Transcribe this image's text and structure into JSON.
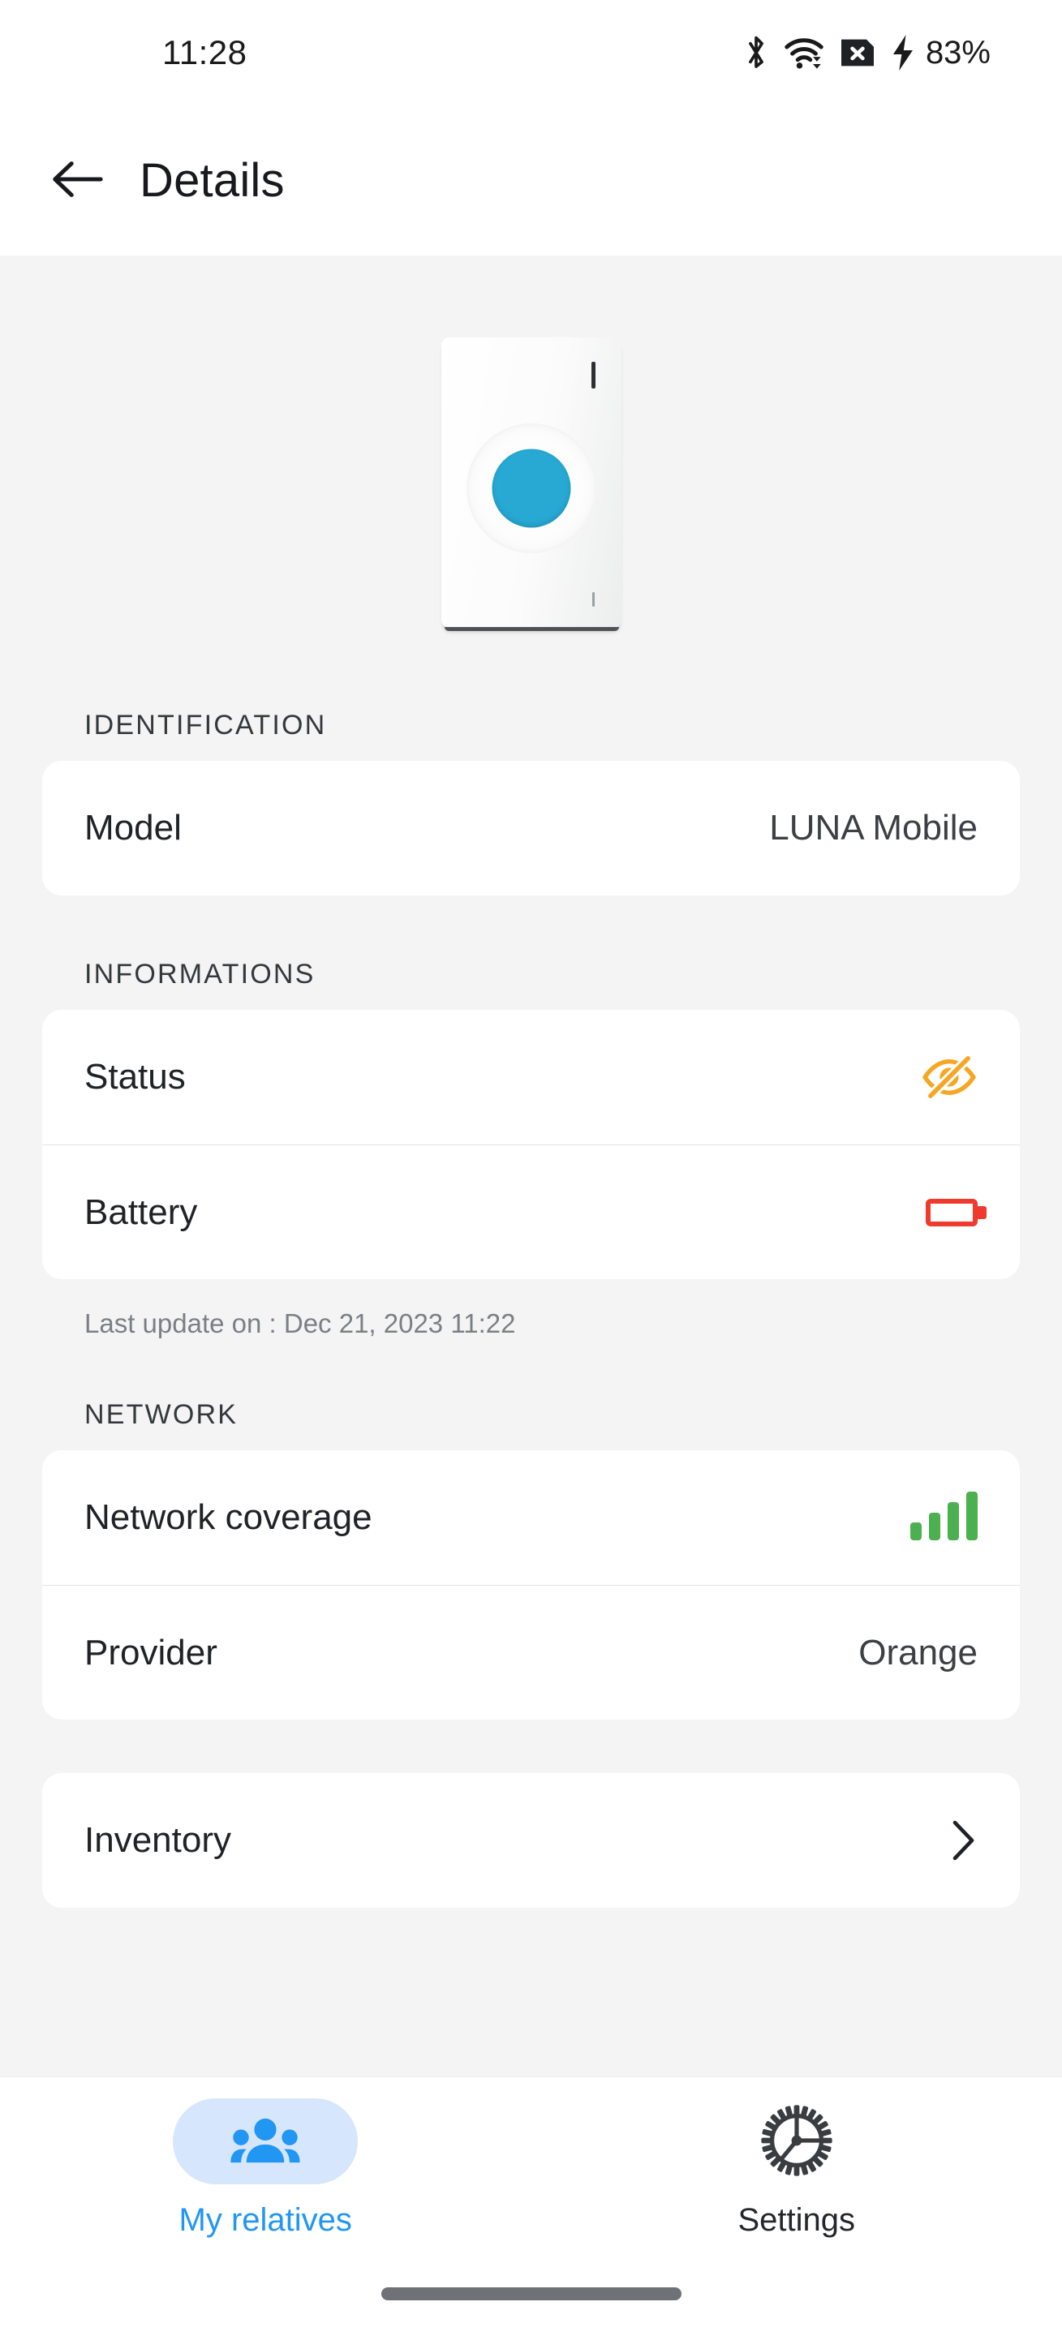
{
  "status_bar": {
    "time": "11:28",
    "battery_percent": "83%",
    "icons": [
      "bluetooth-icon",
      "wifi-icon",
      "sim-card-off-icon",
      "charging-bolt-icon"
    ]
  },
  "app_bar": {
    "back_label": "back-arrow-icon",
    "title": "Details"
  },
  "device_preview": {
    "name": "device-image",
    "button_color": "#27A9D4",
    "body_color": "#FFFFFF"
  },
  "sections": {
    "identification": {
      "label": "IDENTIFICATION",
      "rows": [
        {
          "label": "Model",
          "value": "LUNA Mobile",
          "type": "text"
        }
      ]
    },
    "informations": {
      "label": "INFORMATIONS",
      "rows": [
        {
          "label": "Status",
          "value": "",
          "type": "icon",
          "icon": "eye-off-icon",
          "color": "#F5A623"
        },
        {
          "label": "Battery",
          "value": "",
          "type": "icon",
          "icon": "battery-empty-icon",
          "color": "#EF3B2D"
        }
      ],
      "footnote": "Last update on : Dec 21, 2023 11:22"
    },
    "network": {
      "label": "NETWORK",
      "rows": [
        {
          "label": "Network coverage",
          "value": "",
          "type": "icon",
          "icon": "signal-bars-icon",
          "color": "#4CAF50",
          "bars": 4
        },
        {
          "label": "Provider",
          "value": "Orange",
          "type": "text"
        }
      ]
    },
    "inventory": {
      "rows": [
        {
          "label": "Inventory",
          "value": "",
          "type": "chevron",
          "icon": "chevron-right-icon"
        }
      ]
    }
  },
  "bottom_nav": {
    "items": [
      {
        "label": "My relatives",
        "icon": "people-group-icon",
        "active": true,
        "color": "#2196F3"
      },
      {
        "label": "Settings",
        "icon": "gear-icon",
        "active": false,
        "color": "#242729"
      }
    ]
  }
}
